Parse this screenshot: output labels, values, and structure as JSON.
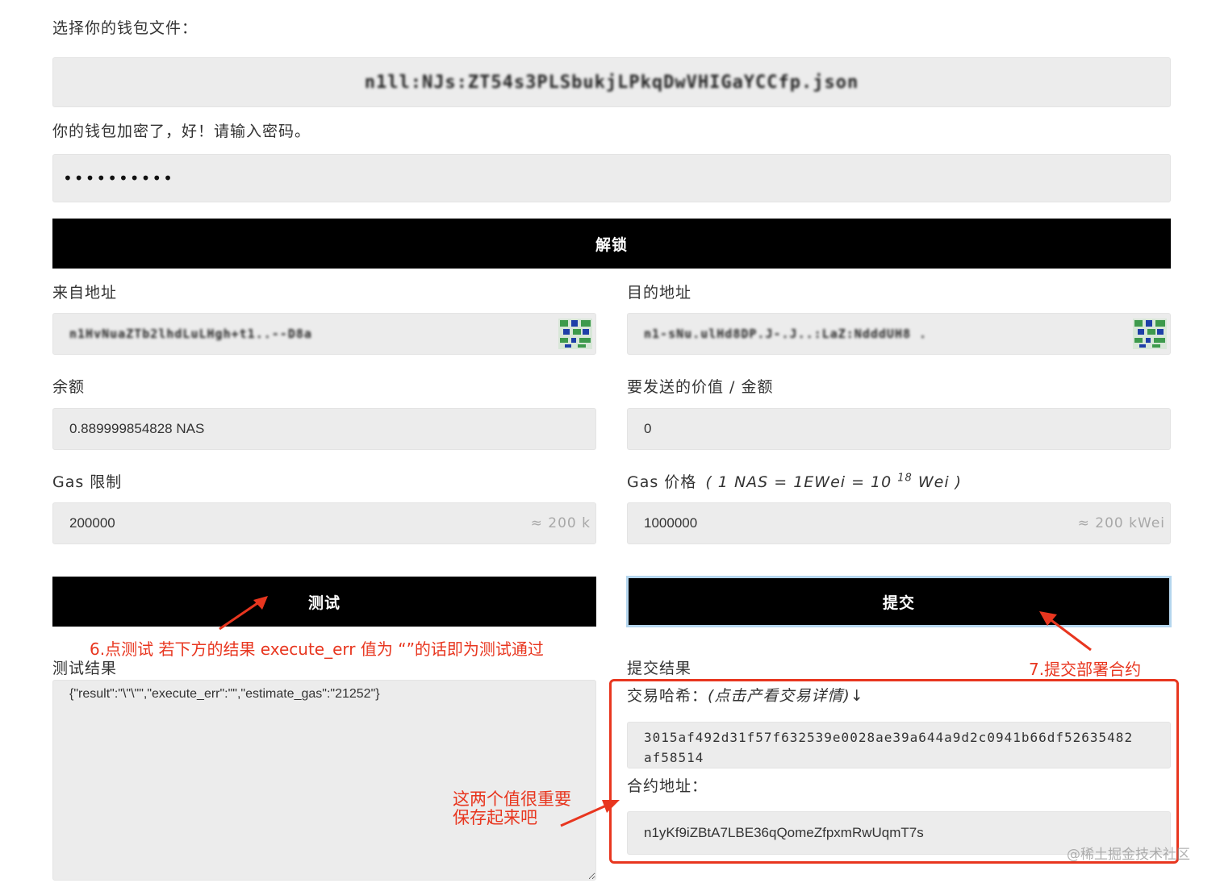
{
  "wallet": {
    "select_label": "选择你的钱包文件：",
    "file_name": "n1ll:NJs:ZT54s3PLSbukjLPkqDwVHIGaYCCfp.json",
    "encrypted_label": "你的钱包加密了，好！请输入密码。",
    "password_mask": "••••••••••",
    "unlock_label": "解锁"
  },
  "from": {
    "label": "来自地址",
    "value": "n1HvNuaZTb2lhdLuLHgh+t1..--D8a"
  },
  "to": {
    "label": "目的地址",
    "value": "n1-sNu.ulHd8DP.J-.J..:LaZ:NdddUH8 ."
  },
  "balance": {
    "label": "余额",
    "value": "0.889999854828 NAS"
  },
  "amount": {
    "label": "要发送的价值 / 金额",
    "value": "0"
  },
  "gas_limit": {
    "label": "Gas 限制",
    "value": "200000",
    "suffix": "≈ 200 k"
  },
  "gas_price": {
    "label_prefix": "Gas 价格",
    "label_formula": "( 1 NAS = 1EWei = 10",
    "label_exp": "18",
    "label_unit": "Wei )",
    "value": "1000000",
    "suffix": "≈ 200 kWei"
  },
  "test": {
    "button_label": "测试",
    "result_label": "测试结果",
    "result_value": "{\"result\":\"\\\"\\\"\",\"execute_err\":\"\",\"estimate_gas\":\"21252\"}"
  },
  "submit": {
    "button_label": "提交",
    "result_label": "提交结果",
    "tx_hash_label": "交易哈希：",
    "tx_hash_hint": "(点击产看交易详情)↓",
    "tx_hash_line1": "3015af492d31f57f632539e0028ae39a644a9d2c0941b66df52635482",
    "tx_hash_line2": "af58514",
    "contract_label": "合约地址：",
    "contract_value": "n1yKf9iZBtA7LBE36qQomeZfpxmRwUqmT7s"
  },
  "annotations": {
    "step6": "6.点测试 若下方的结果 execute_err 值为 “”的话即为测试通过",
    "step7": "7.提交部署合约",
    "save_line1": "这两个值很重要",
    "save_line2": "保存起来吧"
  },
  "watermark": "@稀土掘金技术社区",
  "colors": {
    "annotation_red": "#e8361f",
    "button_black": "#000000",
    "field_gray": "#ececec",
    "qr_green": "#3d9a4c",
    "qr_blue": "#1e3fa8"
  },
  "icons": {
    "qr": "qr-code-icon"
  }
}
